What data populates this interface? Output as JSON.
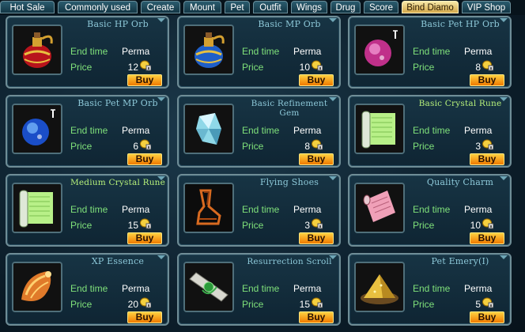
{
  "tabs": [
    {
      "label": "Hot Sale"
    },
    {
      "label": "Commonly used"
    },
    {
      "label": "Create"
    },
    {
      "label": "Mount"
    },
    {
      "label": "Pet"
    },
    {
      "label": "Outfit"
    },
    {
      "label": "Wings"
    },
    {
      "label": "Drug"
    },
    {
      "label": "Score"
    },
    {
      "label": "Bind Diamo",
      "active": true
    },
    {
      "label": "VIP Shop"
    }
  ],
  "labels": {
    "end_time": "End time",
    "price": "Price",
    "buy": "Buy"
  },
  "items": [
    {
      "name": "Basic HP Orb",
      "end_time": "Perma",
      "price": "12",
      "icon": "red-potion-icon"
    },
    {
      "name": "Basic MP Orb",
      "end_time": "Perma",
      "price": "10",
      "icon": "blue-potion-icon"
    },
    {
      "name": "Basic Pet HP Orb",
      "end_time": "Perma",
      "price": "8",
      "icon": "pink-orb-icon"
    },
    {
      "name": "Basic Pet MP Orb",
      "end_time": "Perma",
      "price": "6",
      "icon": "blue-orb-icon"
    },
    {
      "name": "Basic Refinement Gem",
      "end_time": "Perma",
      "price": "8",
      "icon": "crystal-gem-icon"
    },
    {
      "name": "Basic Crystal Rune",
      "end_time": "Perma",
      "price": "3",
      "icon": "green-scroll-icon"
    },
    {
      "name": "Medium Crystal Rune",
      "end_time": "Perma",
      "price": "15",
      "icon": "green-scroll-icon"
    },
    {
      "name": "Flying Shoes",
      "end_time": "Perma",
      "price": "3",
      "icon": "shoes-icon"
    },
    {
      "name": "Quality Charm",
      "end_time": "Perma",
      "price": "10",
      "icon": "pink-scroll-icon"
    },
    {
      "name": "XP Essence",
      "end_time": "Perma",
      "price": "20",
      "icon": "conch-icon"
    },
    {
      "name": "Resurrection Scroll",
      "end_time": "Perma",
      "price": "15",
      "icon": "white-scroll-icon"
    },
    {
      "name": "Pet Emery(I)",
      "end_time": "Perma",
      "price": "5",
      "icon": "gold-pile-icon"
    }
  ]
}
